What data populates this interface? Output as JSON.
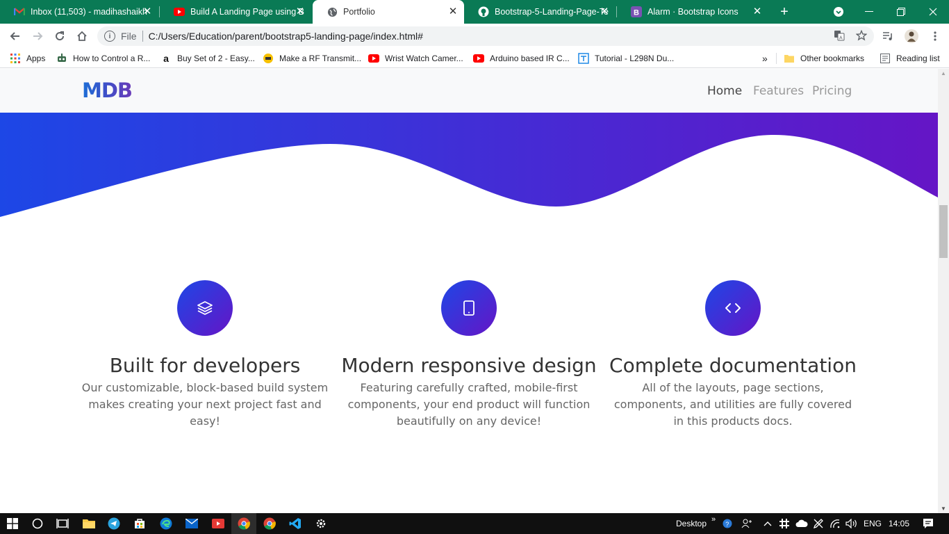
{
  "browser": {
    "tabs": [
      {
        "title": "Inbox (11,503) - madihashaikh",
        "icon": "gmail-icon"
      },
      {
        "title": "Build A Landing Page using B",
        "icon": "youtube-icon"
      },
      {
        "title": "Portfolio",
        "icon": "globe-icon"
      },
      {
        "title": "Bootstrap-5-Landing-Page-Te",
        "icon": "github-icon"
      },
      {
        "title": "Alarm · Bootstrap Icons",
        "icon": "bootstrap-icon"
      }
    ],
    "close_glyph": "✕",
    "new_tab_glyph": "+",
    "address": {
      "scheme_label": "File",
      "url": "C:/Users/Education/parent/bootstrap5-landing-page/index.html#"
    },
    "bookmarks": [
      {
        "label": "Apps"
      },
      {
        "label": "How to Control a R..."
      },
      {
        "label": "Buy Set of 2 - Easy..."
      },
      {
        "label": "Make a RF Transmit..."
      },
      {
        "label": "Wrist Watch Camer..."
      },
      {
        "label": "Arduino based IR C..."
      },
      {
        "label": "Tutorial - L298N Du..."
      }
    ],
    "bookmarks_overflow": "»",
    "other_bookmarks": "Other bookmarks",
    "reading_list": "Reading list"
  },
  "page": {
    "brand": "MDB",
    "nav": [
      {
        "label": "Home"
      },
      {
        "label": "Features"
      },
      {
        "label": "Pricing"
      }
    ],
    "features": [
      {
        "icon": "layers-icon",
        "title": "Built for developers",
        "text": "Our customizable, block-based build system makes creating your next project fast and easy!"
      },
      {
        "icon": "tablet-icon",
        "title": "Modern responsive design",
        "text": "Featuring carefully crafted, mobile-first components, your end product will function beautifully on any device!"
      },
      {
        "icon": "code-icon",
        "title": "Complete documentation",
        "text": "All of the layouts, page sections, components, and utilities are fully covered in this products docs."
      }
    ],
    "colors": {
      "gradient_start": "#1d47e6",
      "gradient_end": "#6515c6",
      "tab_strip": "#0a7a55"
    }
  },
  "taskbar": {
    "desktop_label": "Desktop",
    "language": "ENG",
    "time": "14:05"
  }
}
